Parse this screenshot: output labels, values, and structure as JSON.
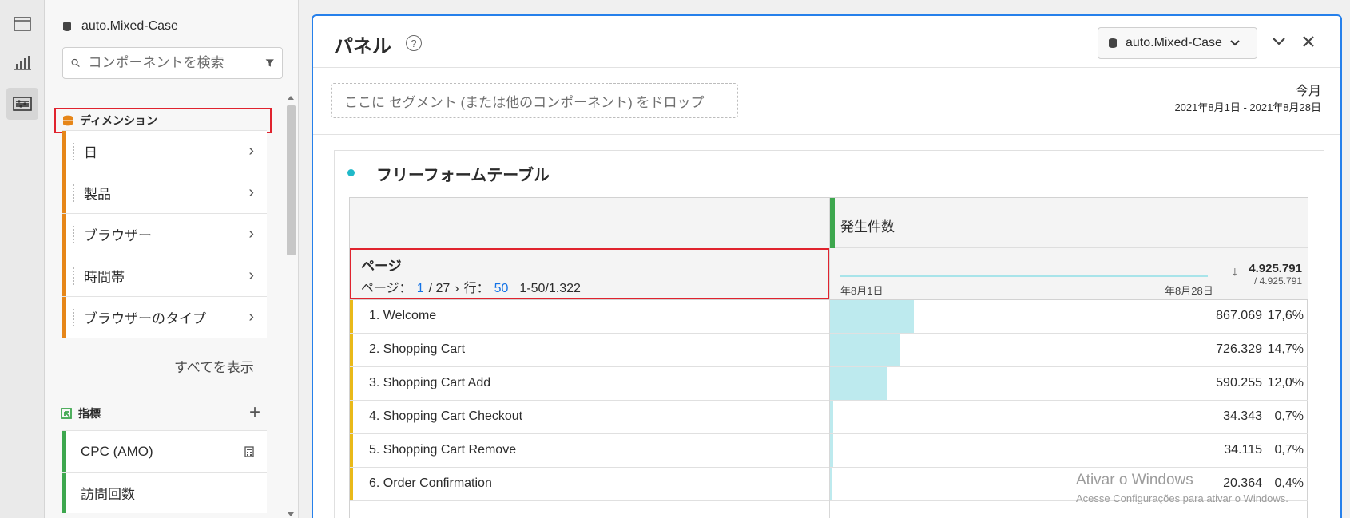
{
  "components": {
    "report_suite": "auto.Mixed-Case",
    "search_placeholder": "コンポーネントを検索",
    "dimensions_heading": "ディメンション",
    "dimensions": [
      {
        "label": "日"
      },
      {
        "label": "製品"
      },
      {
        "label": "ブラウザー"
      },
      {
        "label": "時間帯"
      },
      {
        "label": "ブラウザーのタイプ"
      }
    ],
    "show_all": "すべてを表示",
    "metrics_heading": "指標",
    "metrics": [
      {
        "label": "CPC (AMO)",
        "icon": "calculator-icon"
      },
      {
        "label": "訪問回数"
      }
    ]
  },
  "panel": {
    "title": "パネル",
    "report_suite": "auto.Mixed-Case",
    "drop_zone": "ここに セグメント (または他のコンポーネント) をドロップ",
    "date_label": "今月",
    "date_range": "2021年8月1日 - 2021年8月28日"
  },
  "freeform": {
    "title": "フリーフォームテーブル",
    "metric": "発生件数",
    "dimension": "ページ",
    "pager": {
      "page_label": "ページ：",
      "page": "1",
      "total_pages": "/ 27",
      "rows_label": "行：",
      "rows": "50",
      "range": "1-50/1.322"
    },
    "spark_start": "年8月1日",
    "spark_end": "年8月28日",
    "total": "4.925.791",
    "total_sub": "/ 4.925.791",
    "rows": [
      {
        "label": "1. Welcome",
        "value": "867.069",
        "pct": "17,6%",
        "share": 0.176
      },
      {
        "label": "2. Shopping Cart",
        "value": "726.329",
        "pct": "14,7%",
        "share": 0.147
      },
      {
        "label": "3. Shopping Cart Add",
        "value": "590.255",
        "pct": "12,0%",
        "share": 0.12
      },
      {
        "label": "4. Shopping Cart Checkout",
        "value": "34.343",
        "pct": "0,7%",
        "share": 0.007
      },
      {
        "label": "5. Shopping Cart Remove",
        "value": "34.115",
        "pct": "0,7%",
        "share": 0.007
      },
      {
        "label": "6. Order Confirmation",
        "value": "20.364",
        "pct": "0,4%",
        "share": 0.004
      }
    ]
  },
  "watermark": {
    "line1": "Ativar o Windows",
    "line2": "Acesse Configurações para ativar o Windows."
  },
  "colors": {
    "accent": "#2680eb",
    "dimension": "#e68619",
    "metric": "#3da74e",
    "highlight": "#e0232e",
    "bar_fill": "#bdeaee"
  }
}
